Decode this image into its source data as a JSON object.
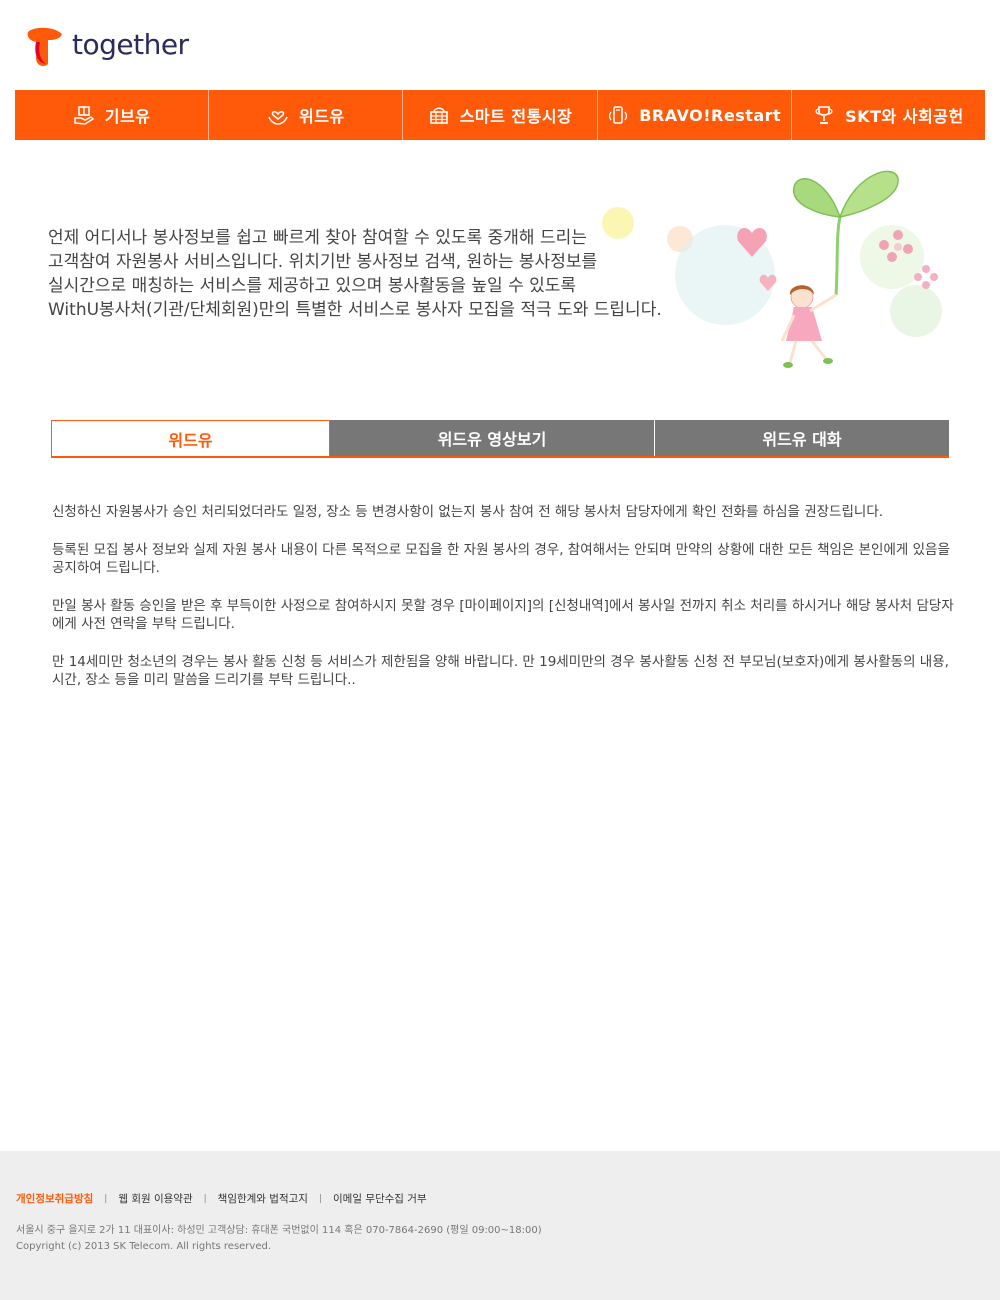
{
  "header": {
    "logo_text": "together"
  },
  "gnb": {
    "items": [
      {
        "label": "기브유",
        "icon": "gift-hand-icon"
      },
      {
        "label": "위드유",
        "icon": "heart-hands-icon"
      },
      {
        "label": "스마트 전통시장",
        "icon": "basket-icon"
      },
      {
        "label": "BRAVO!Restart",
        "icon": "mobile-phone-icon"
      },
      {
        "label": "SKT와 사회공헌",
        "icon": "trophy-icon"
      }
    ]
  },
  "intro": {
    "lines": [
      "언제 어디서나 봉사정보를 쉽고 빠르게 찾아 참여할 수 있도록 중개해 드리는",
      "고객참여 자원봉사 서비스입니다. 위치기반 봉사정보 검색, 원하는 봉사정보를",
      "실시간으로 매칭하는 서비스를 제공하고 있으며 봉사활동을 높일 수 있도록",
      "WithU봉사처(기관/단체회원)만의 특별한 서비스로 봉사자 모집을 적극 도와 드립니다."
    ]
  },
  "tabs": [
    {
      "label": "위드유",
      "active": true
    },
    {
      "label": "위드유 영상보기",
      "active": false
    },
    {
      "label": "위드유 대화",
      "active": false
    }
  ],
  "notices": [
    "신청하신 자원봉사가 승인 처리되었더라도 일정, 장소 등 변경사항이 없는지 봉사 참여 전 해당 봉사처 담당자에게 확인 전화를 하심을 권장드립니다.",
    "등록된 모집 봉사 정보와 실제 자원 봉사 내용이 다른 목적으로 모집을 한 자원 봉사의 경우, 참여해서는 안되며 만약의 상황에 대한 모든 책임은 본인에게 있음을 공지하여 드립니다.",
    "만일 봉사 활동 승인을 받은 후 부득이한 사정으로 참여하시지 못할 경우 [마이페이지]의 [신청내역]에서 봉사일 전까지 취소 처리를 하시거나 해당 봉사처 담당자에게 사전 연락을 부탁 드립니다.",
    "만 14세미만 청소년의 경우는 봉사 활동 신청 등 서비스가 제한됨을 양해 바랍니다. 만 19세미만의 경우 봉사활동  신청 전 부모님(보호자)에게 봉사활동의 내용, 시간, 장소 등을 미리 말씀을 드리기를 부탁 드립니다.."
  ],
  "footer": {
    "links": [
      "개인정보취급방침",
      "웹 회원 이용약관",
      "책임한계와 법적고지",
      "이메일 무단수집 거부"
    ],
    "address": "서울시 중구 을지로 2가 11    대표이사: 하성민    고객상담: 휴대폰 국번없이 114 혹은 070-7864-2690 (평일 09:00~18:00)",
    "copyright": "Copyright (c) 2013 SK Telecom. All rights reserved."
  },
  "colors": {
    "accent": "#ff5a0a",
    "tab_inactive": "#777777",
    "footer_bg": "#eeeeee"
  }
}
